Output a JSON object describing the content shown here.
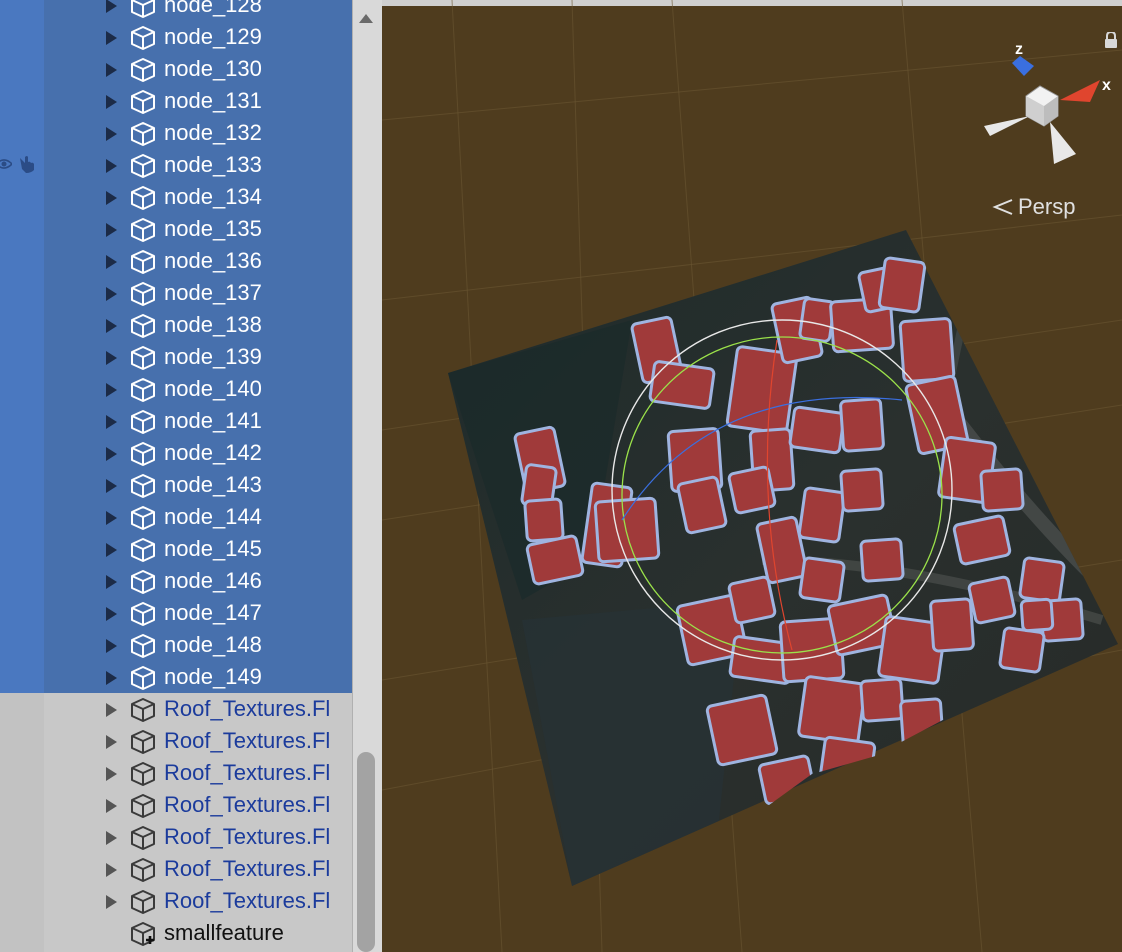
{
  "hierarchy": {
    "items": [
      {
        "label": "node_128",
        "selected": true,
        "expandable": true
      },
      {
        "label": "node_129",
        "selected": true,
        "expandable": true
      },
      {
        "label": "node_130",
        "selected": true,
        "expandable": true
      },
      {
        "label": "node_131",
        "selected": true,
        "expandable": true
      },
      {
        "label": "node_132",
        "selected": true,
        "expandable": true
      },
      {
        "label": "node_133",
        "selected": true,
        "expandable": true
      },
      {
        "label": "node_134",
        "selected": true,
        "expandable": true
      },
      {
        "label": "node_135",
        "selected": true,
        "expandable": true
      },
      {
        "label": "node_136",
        "selected": true,
        "expandable": true
      },
      {
        "label": "node_137",
        "selected": true,
        "expandable": true
      },
      {
        "label": "node_138",
        "selected": true,
        "expandable": true
      },
      {
        "label": "node_139",
        "selected": true,
        "expandable": true
      },
      {
        "label": "node_140",
        "selected": true,
        "expandable": true
      },
      {
        "label": "node_141",
        "selected": true,
        "expandable": true
      },
      {
        "label": "node_142",
        "selected": true,
        "expandable": true
      },
      {
        "label": "node_143",
        "selected": true,
        "expandable": true
      },
      {
        "label": "node_144",
        "selected": true,
        "expandable": true
      },
      {
        "label": "node_145",
        "selected": true,
        "expandable": true
      },
      {
        "label": "node_146",
        "selected": true,
        "expandable": true
      },
      {
        "label": "node_147",
        "selected": true,
        "expandable": true
      },
      {
        "label": "node_148",
        "selected": true,
        "expandable": true
      },
      {
        "label": "node_149",
        "selected": true,
        "expandable": true
      },
      {
        "label": "Roof_Textures.Fl",
        "selected": false,
        "expandable": true
      },
      {
        "label": "Roof_Textures.Fl",
        "selected": false,
        "expandable": true
      },
      {
        "label": "Roof_Textures.Fl",
        "selected": false,
        "expandable": true
      },
      {
        "label": "Roof_Textures.Fl",
        "selected": false,
        "expandable": true
      },
      {
        "label": "Roof_Textures.Fl",
        "selected": false,
        "expandable": true
      },
      {
        "label": "Roof_Textures.Fl",
        "selected": false,
        "expandable": true
      },
      {
        "label": "Roof_Textures.Fl",
        "selected": false,
        "expandable": true
      },
      {
        "label": "smallfeature",
        "selected": false,
        "expandable": false
      }
    ]
  },
  "scene": {
    "gizmo": {
      "axis_z": "z",
      "axis_x": "x"
    },
    "projection_label": "Persp"
  },
  "colors": {
    "selection": "#4770ad",
    "scene_background": "#4f3c1e",
    "axis_x": "#e0452e",
    "axis_y": "#9be24a",
    "axis_z": "#3a6fe0",
    "roof": "#a03a3a",
    "outline": "#9fb4e0"
  },
  "icons": [
    "cube-icon",
    "eye-icon",
    "hand-pick-icon",
    "expand-arrow-icon",
    "lock-icon",
    "add-badge-icon",
    "persp-chevron-icon"
  ]
}
